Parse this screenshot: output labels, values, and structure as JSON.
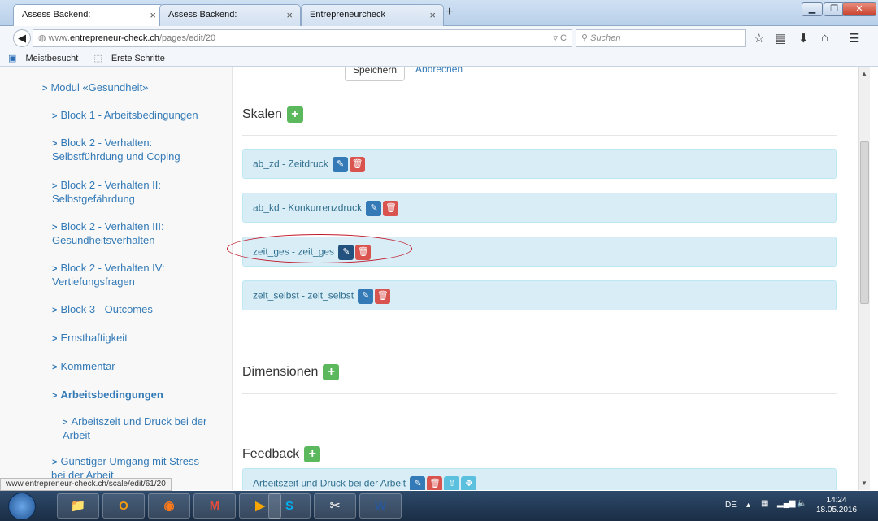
{
  "browser": {
    "tabs": [
      {
        "label": "Assess Backend:",
        "active": true
      },
      {
        "label": "Assess Backend:",
        "active": false
      },
      {
        "label": "Entrepreneurcheck",
        "active": false
      }
    ],
    "url_prefix": "www.",
    "url_domain": "entrepreneur-check.ch",
    "url_path": "/pages/edit/20",
    "search_placeholder": "Suchen",
    "bookmarks": [
      "Meistbesucht",
      "Erste Schritte"
    ],
    "status_link": "www.entrepreneur-check.ch/scale/edit/61/20"
  },
  "sidebar": {
    "items": [
      {
        "label": "Modul «Gesundheit»"
      },
      {
        "label": "Block 1 - Arbeitsbedingungen"
      },
      {
        "label": "Block 2 - Verhalten:",
        "label2": "Selbstführdung und Coping"
      },
      {
        "label": "Block 2 - Verhalten II:",
        "label2": "Selbstgefährdung"
      },
      {
        "label": "Block 2 - Verhalten III:",
        "label2": "Gesundheitsverhalten"
      },
      {
        "label": "Block 2 - Verhalten IV:",
        "label2": "Vertiefungsfragen"
      },
      {
        "label": "Block 3 - Outcomes"
      },
      {
        "label": "Ernsthaftigkeit"
      },
      {
        "label": "Kommentar"
      },
      {
        "label": "Arbeitsbedingungen"
      },
      {
        "label": "Arbeitszeit und Druck bei der",
        "label2": "Arbeit"
      },
      {
        "label": "Günstiger Umgang mit Stress",
        "label2": "bei der Arbeit"
      }
    ]
  },
  "main": {
    "save_label": "Speichern",
    "cancel_label": "Abbrechen",
    "skalen_title": "Skalen",
    "scales": [
      {
        "label": "ab_zd - Zeitdruck"
      },
      {
        "label": "ab_kd - Konkurrenzdruck"
      },
      {
        "label": "zeit_ges - zeit_ges"
      },
      {
        "label": "zeit_selbst - zeit_selbst"
      }
    ],
    "dimensionen_title": "Dimensionen",
    "feedback_title": "Feedback",
    "feedback_items": [
      {
        "label": "Arbeitszeit und Druck bei der Arbeit"
      }
    ]
  },
  "taskbar": {
    "lang": "DE",
    "time": "14:24",
    "date": "18.05.2016"
  },
  "colors": {
    "link": "#337ab7",
    "success": "#5cb85c",
    "danger": "#d9534f",
    "info_bg": "#d9edf7",
    "highlight": "#c0192b"
  }
}
